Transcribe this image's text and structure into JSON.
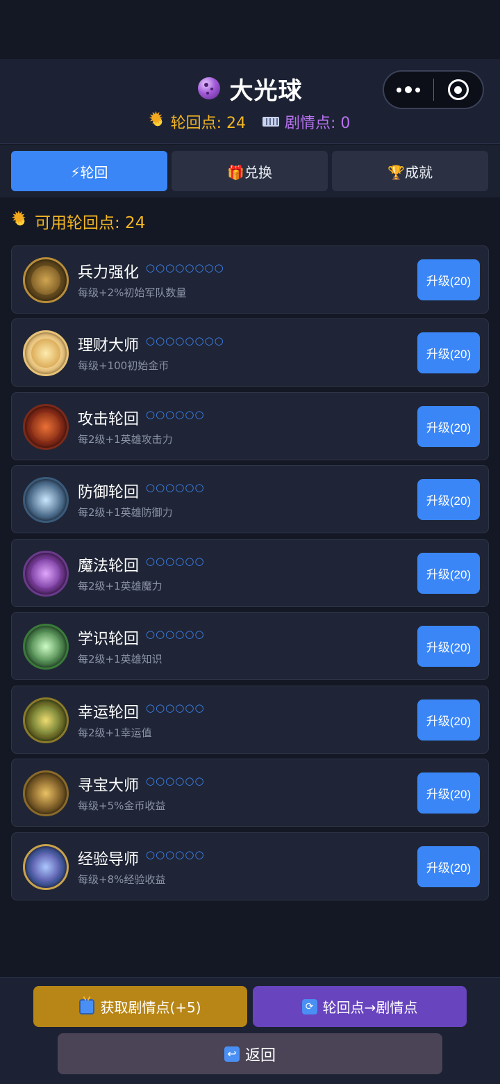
{
  "header": {
    "title": "大光球",
    "cycle_points_label": "轮回点: 24",
    "story_points_label": "剧情点: 0"
  },
  "capsule": {
    "more_icon": "more-dots-icon",
    "close_icon": "target-close-icon"
  },
  "tabs": [
    {
      "label": "⚡轮回",
      "active": true
    },
    {
      "label": "🎁兑换",
      "active": false
    },
    {
      "label": "🏆成就",
      "active": false
    }
  ],
  "available": {
    "label": "可用轮回点: 24"
  },
  "skills": [
    {
      "name": "兵力强化",
      "dots": "○○○○○○○○",
      "desc": "每级+2%初始军队数量",
      "button": "升级(20)"
    },
    {
      "name": "理财大师",
      "dots": "○○○○○○○○",
      "desc": "每级+100初始金币",
      "button": "升级(20)"
    },
    {
      "name": "攻击轮回",
      "dots": "○○○○○○",
      "desc": "每2级+1英雄攻击力",
      "button": "升级(20)"
    },
    {
      "name": "防御轮回",
      "dots": "○○○○○○",
      "desc": "每2级+1英雄防御力",
      "button": "升级(20)"
    },
    {
      "name": "魔法轮回",
      "dots": "○○○○○○",
      "desc": "每2级+1英雄魔力",
      "button": "升级(20)"
    },
    {
      "name": "学识轮回",
      "dots": "○○○○○○",
      "desc": "每2级+1英雄知识",
      "button": "升级(20)"
    },
    {
      "name": "幸运轮回",
      "dots": "○○○○○○",
      "desc": "每2级+1幸运值",
      "button": "升级(20)"
    },
    {
      "name": "寻宝大师",
      "dots": "○○○○○○",
      "desc": "每级+5%金币收益",
      "button": "升级(20)"
    },
    {
      "name": "经验导师",
      "dots": "○○○○○○",
      "desc": "每级+8%经验收益",
      "button": "升级(20)"
    }
  ],
  "footer": {
    "get_story_label": "获取剧情点(+5)",
    "convert_label": "轮回点→剧情点",
    "back_label": "返回"
  },
  "colors": {
    "accent_blue": "#3a86f7",
    "gold": "#f4b623",
    "purple": "#b772ef",
    "background": "#141824"
  }
}
